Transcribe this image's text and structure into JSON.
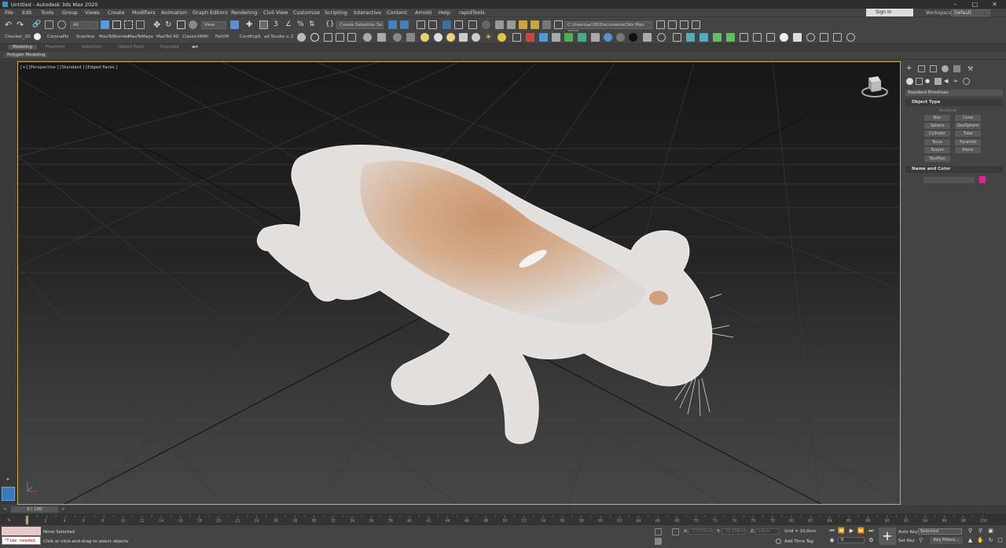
{
  "window": {
    "title": "Untitled - Autodesk 3ds Max 2020"
  },
  "menus": [
    "File",
    "Edit",
    "Tools",
    "Group",
    "Views",
    "Create",
    "Modifiers",
    "Animation",
    "Graph Editors",
    "Rendering",
    "Civil View",
    "Customize",
    "Scripting",
    "Interactive",
    "Content",
    "Arnold",
    "Help",
    "rapidTools"
  ],
  "account": {
    "sign_in": "Sign In",
    "workspaces_label": "Workspaces:",
    "workspace": "Default"
  },
  "toolbar": {
    "selection_filter": "All",
    "ref_coord": "View",
    "named_selection": "Create Selection Se",
    "project_path": "C:\\Users\\art30\\Documents\\3ds Max 2020",
    "scripts": [
      {
        "label": "Checker_3D"
      },
      {
        "label": "CoronaPix"
      },
      {
        "label": "Scanline"
      },
      {
        "label": "MaxToBlender"
      },
      {
        "label": "MaxToMaya"
      },
      {
        "label": "MaxToC4D"
      },
      {
        "label": "ClassicVRMI"
      },
      {
        "label": "FallOff"
      },
      {
        "label": "ContExpS"
      },
      {
        "label": "ad Studio v..2"
      }
    ]
  },
  "ribbon": {
    "tabs": [
      "Modeling",
      "Freeform",
      "Selection",
      "Object Paint",
      "Populate"
    ],
    "active_tab": "Modeling",
    "panel": "Polygon Modeling"
  },
  "viewport": {
    "label": "[+] [Perspective ] [Standard ] [Edged Faces ]"
  },
  "command_panel": {
    "category": "Standard Primitives",
    "object_type_title": "Object Type",
    "autogrid": "AutoGrid",
    "primitives": [
      "Box",
      "Cone",
      "Sphere",
      "GeoSphere",
      "Cylinder",
      "Tube",
      "Torus",
      "Pyramid",
      "Teapot",
      "Plane",
      "TextPlus"
    ],
    "name_color_title": "Name and Color",
    "object_color": "#d42b8a"
  },
  "timeline": {
    "frame_display": "0 / 100",
    "ticks": [
      "0",
      "2",
      "4",
      "6",
      "8",
      "10",
      "12",
      "14",
      "16",
      "18",
      "20",
      "22",
      "24",
      "26",
      "28",
      "30",
      "32",
      "34",
      "36",
      "38",
      "40",
      "42",
      "44",
      "46",
      "48",
      "50",
      "52",
      "54",
      "56",
      "58",
      "60",
      "62",
      "64",
      "66",
      "68",
      "70",
      "72",
      "74",
      "76",
      "78",
      "80",
      "82",
      "84",
      "86",
      "88",
      "90",
      "92",
      "94",
      "96",
      "98",
      "100"
    ]
  },
  "status": {
    "maxscript_text": "\"Time needed",
    "selection_status": "None Selected",
    "prompt": "Click or click-and-drag to select objects",
    "x_label": "X:",
    "x_value": "-13,535cm",
    "y_label": "Y:",
    "y_value": "-39,378cm",
    "z_label": "Z:",
    "z_value": "0,0cm",
    "grid": "Grid = 10,0cm",
    "add_time_tag": "Add Time Tag",
    "auto_key": "Auto Key",
    "set_key": "Set Key",
    "key_mode": "Selected",
    "key_filters": "Key Filters...",
    "current_frame": "0"
  },
  "colors": {
    "viewport_border": "#c9a84b",
    "accent_blue": "#3a8fc6"
  }
}
